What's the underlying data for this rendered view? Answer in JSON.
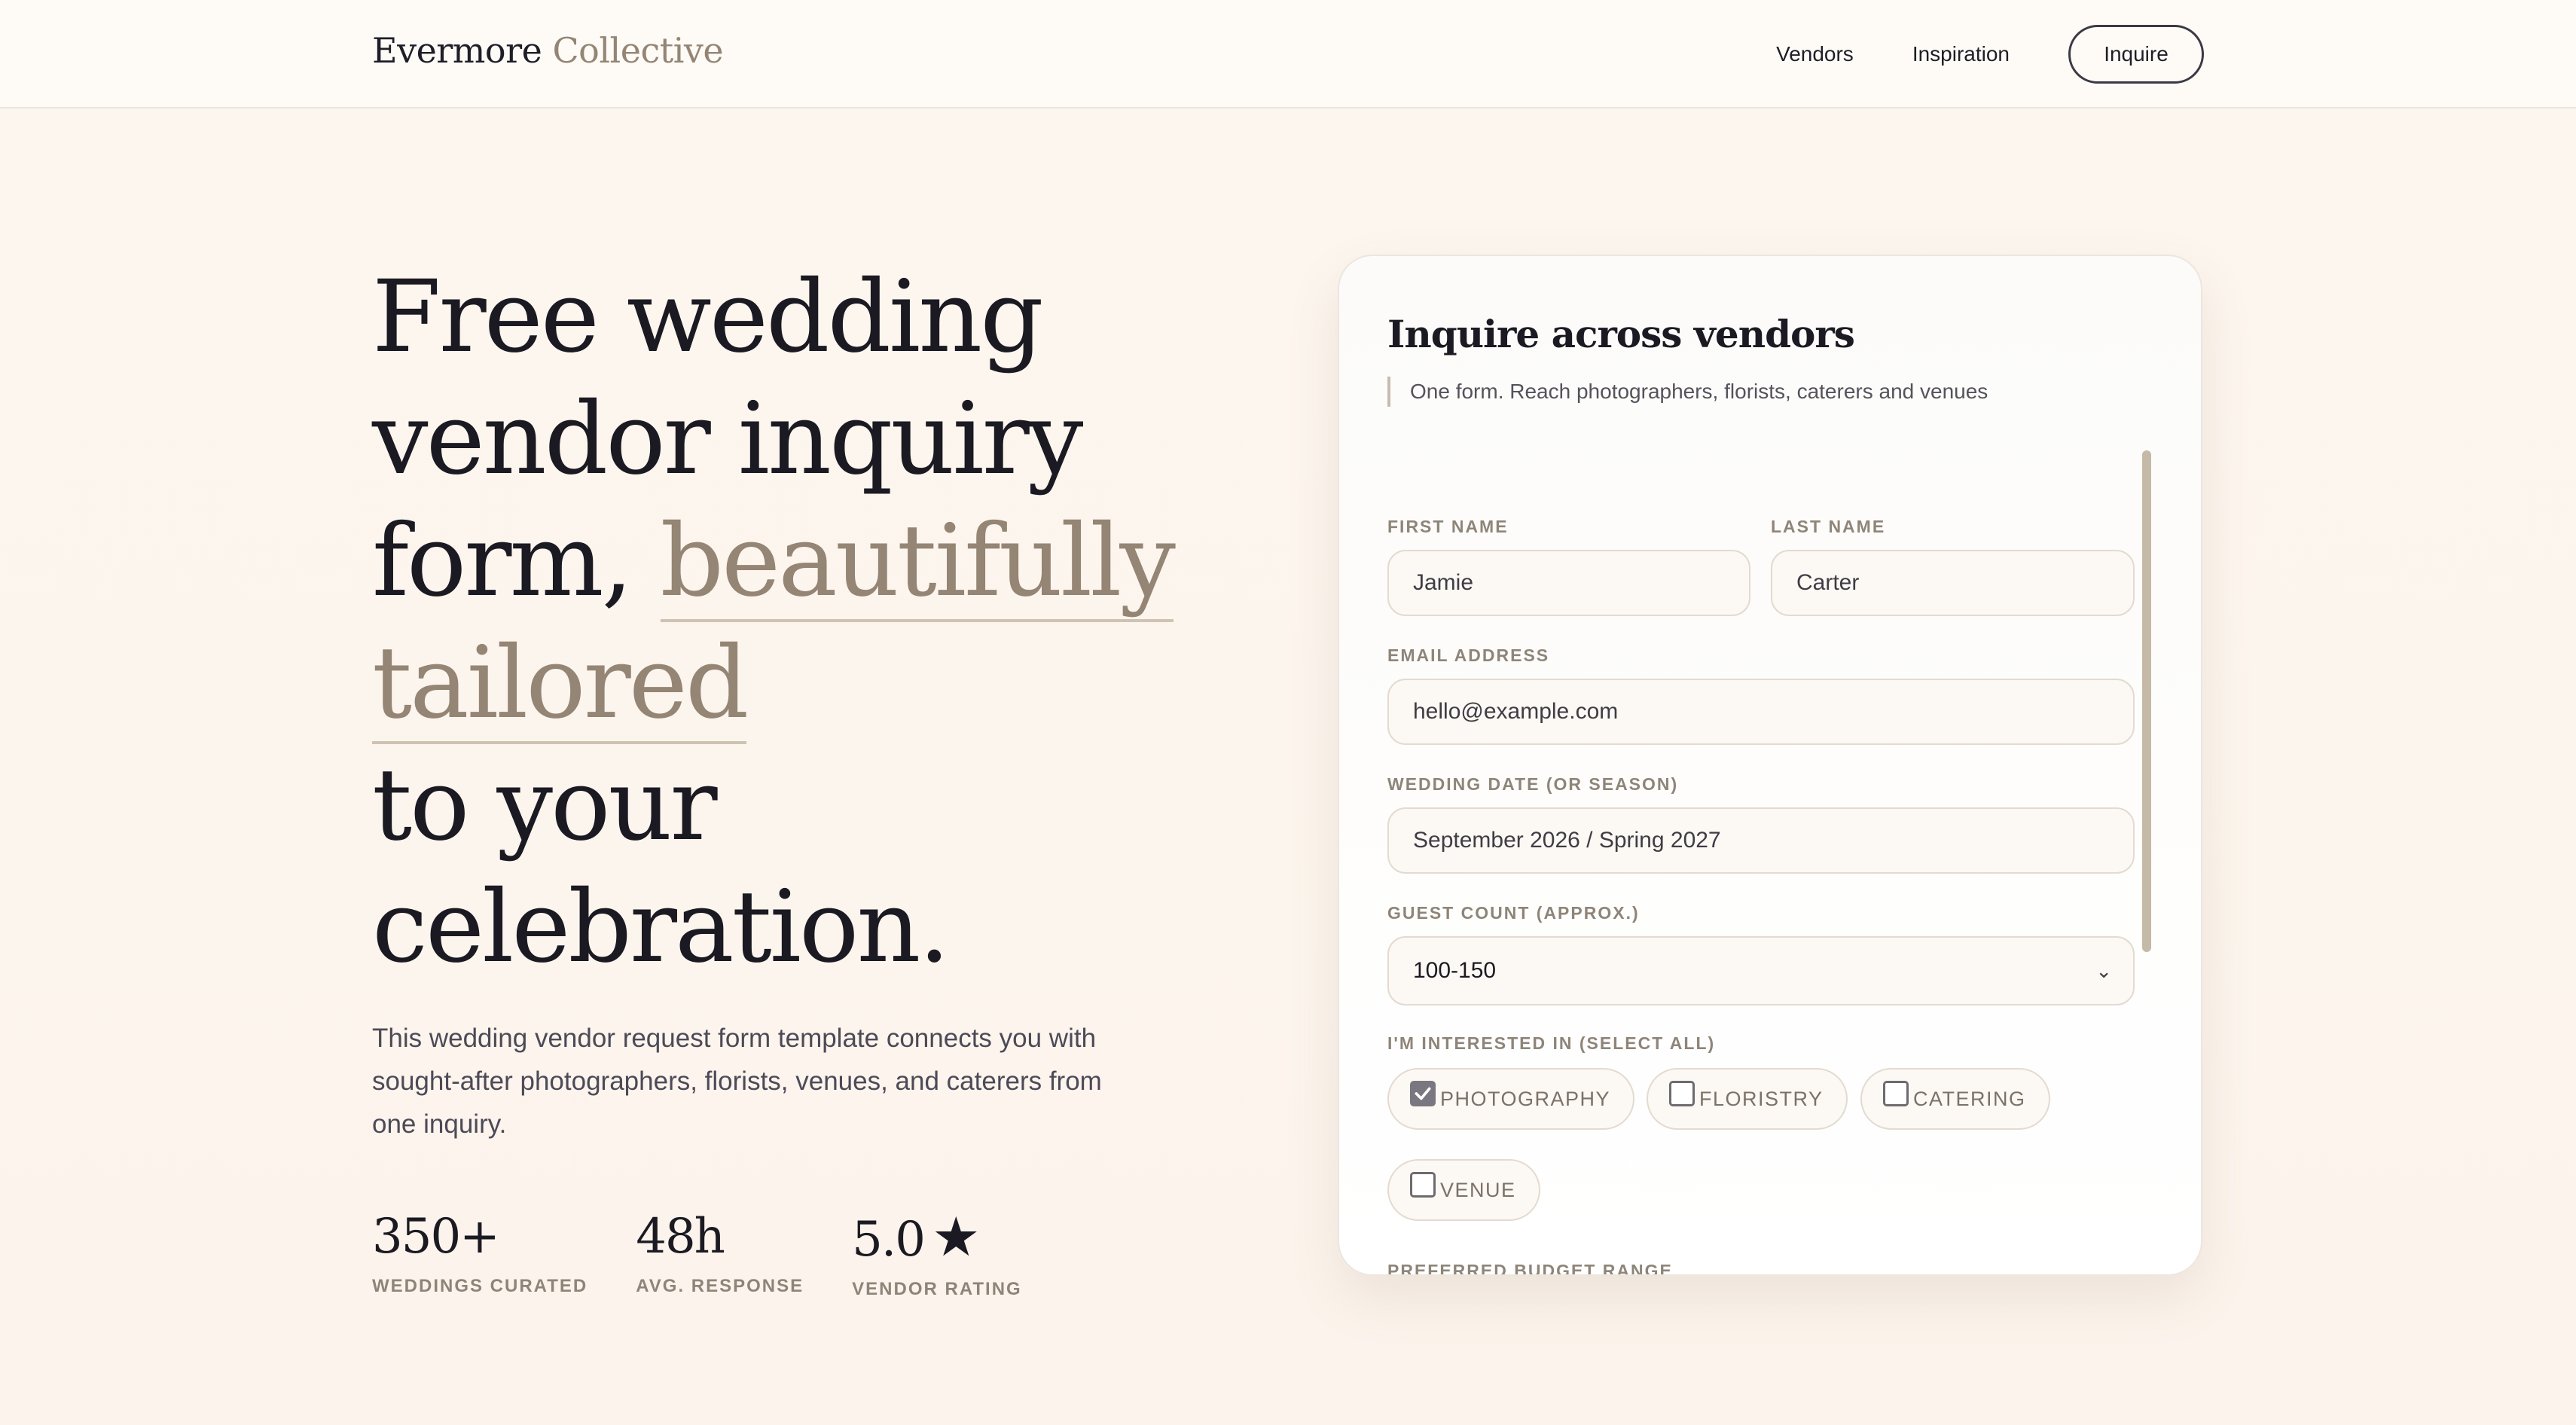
{
  "header": {
    "brand_primary": "Evermore",
    "brand_accent": "Collective",
    "nav": [
      "Vendors",
      "Inspiration"
    ],
    "cta_label": "Inquire"
  },
  "hero": {
    "line1": "Free wedding",
    "line2": "vendor inquiry",
    "line3_plain": "form, ",
    "line3_highlight": "beautifully",
    "line4_highlight": "tailored",
    "line5": "to your",
    "line6": "celebration.",
    "subtitle": "This wedding vendor request form template connects you with sought-after photographers, florists, venues, and caterers from one inquiry."
  },
  "stats": [
    {
      "value": "350+",
      "label": "Weddings curated"
    },
    {
      "value": "48h",
      "label": "Avg. response"
    },
    {
      "value": "5.0",
      "label": "Vendor rating"
    }
  ],
  "form": {
    "title": "Inquire across vendors",
    "subtitle": "One form. Reach photographers, florists, caterers and venues",
    "first_name": {
      "label": "First name",
      "value": "Jamie"
    },
    "last_name": {
      "label": "Last name",
      "value": "Carter"
    },
    "email": {
      "label": "Email address",
      "placeholder": "hello@example.com"
    },
    "wedding_date": {
      "label": "Wedding date (or season)",
      "placeholder": "September 2026 / Spring 2027"
    },
    "guest_count": {
      "label": "Guest count (approx.)",
      "value": "100-150"
    },
    "interests": {
      "label": "I'm interested in (select all)",
      "options": [
        {
          "label": "Photography",
          "checked": true
        },
        {
          "label": "Floristry",
          "checked": false
        },
        {
          "label": "Catering",
          "checked": false
        },
        {
          "label": "Venue",
          "checked": false
        }
      ]
    },
    "budget": {
      "label": "Preferred budget range"
    }
  },
  "colors": {
    "accent": "#948574",
    "ink": "#1b1a22",
    "background": "#fdf6ef",
    "muted": "#8e8579"
  }
}
